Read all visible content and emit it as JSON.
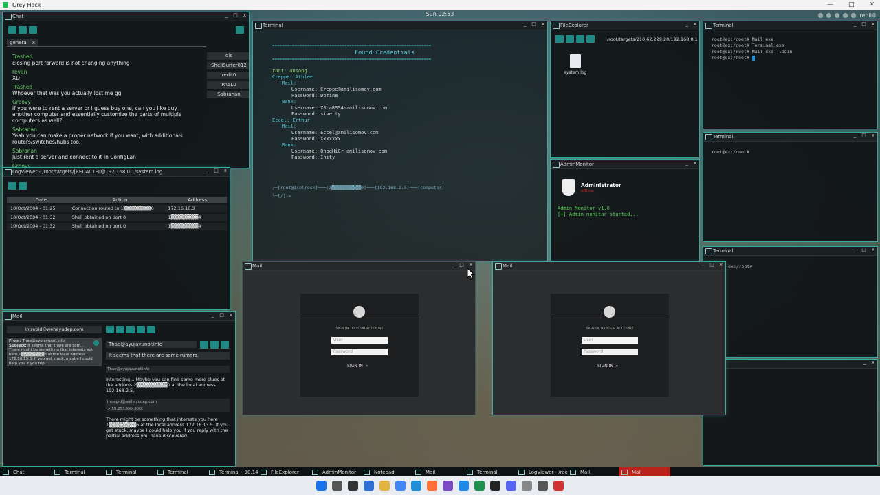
{
  "host": {
    "title": "Grey Hack"
  },
  "clock": "Sun 02:53",
  "tray": {
    "user": "redit0"
  },
  "chat": {
    "title": "Chat",
    "channel": "general",
    "channel_close": "x",
    "messages": [
      {
        "name": "Trashed",
        "text": "closing port forward is not changing anything"
      },
      {
        "name": "revan",
        "text": "XD"
      },
      {
        "name": "Trashed",
        "text": "Whoever that was you actually lost me gg"
      },
      {
        "name": "Groovy",
        "text": "if you were to rent a server or i guess buy one, can you like buy another computer and essentially customize the parts of multiple computers as well?"
      },
      {
        "name": "Sabranan",
        "text": "Yeah you can make a proper network if you want, with additionals routers/switches/hubs too."
      },
      {
        "name": "Sabranan",
        "text": "Just rent a server and connect to it in ConfigLan"
      },
      {
        "name": "Groovy",
        "text": ""
      }
    ],
    "users": [
      "dis",
      "ShellSurfer012",
      "redit0",
      "PA5L0",
      "Sabranan"
    ]
  },
  "logviewer": {
    "title": "LogViewer - /root/targets/[REDACTED]/192.168.0.1/system.log",
    "headers": [
      "Date",
      "Action",
      "Address"
    ],
    "rows": [
      {
        "date": "10/Oct/2004 - 01:25",
        "action": "Connection routed to 1▓▓▓▓▓▓▓▓6",
        "address": "172.16.16.3"
      },
      {
        "date": "10/Oct/2004 - 01:32",
        "action": "Shell obtained on port 0",
        "address": "1▓▓▓▓▓▓▓▓4"
      },
      {
        "date": "10/Oct/2004 - 01:32",
        "action": "Shell obtained on port 0",
        "address": "1▓▓▓▓▓▓▓▓4"
      }
    ]
  },
  "mail_left": {
    "title": "Mail",
    "account": "intrepid@wehayudep.com",
    "preview": {
      "from_label": "From:",
      "from": "Thae@ayujavunof.info",
      "subject_label": "Subject:",
      "subject": "It seems that there are som...",
      "body": "There might be something that interests you here 1▓▓▓▓▓▓▓▓6 at the local address 172.16.13.5. If you get stuck, maybe I could help you if you repl"
    },
    "to": "Thae@ayujavunof.info",
    "subject_line": "It seems that there are some rumors.",
    "thread": [
      {
        "sender": "Thae@ayujavunof.info",
        "body": "Interesting... Maybe you can find some more clues at the address 2▓▓▓▓▓▓▓▓▓0 at the local address 192.168.2.5."
      },
      {
        "sender": "intrepid@wehayudep.com",
        "body": "> 59.253.XXX.XXX"
      },
      {
        "sender": "",
        "body": "There might be something that interests you here 1▓▓▓▓▓▓▓▓6 at the local address 172.16.13.5. If you get stuck, maybe I could help you if you reply with the partial address you have discovered."
      }
    ]
  },
  "terminal_main": {
    "title": "Terminal",
    "rule": "================================================================",
    "heading": "Found Credentials",
    "lines": [
      {
        "t": "root: ansong",
        "c": "t-green",
        "i": 0
      },
      {
        "t": "Creppe: Athlee",
        "c": "t-cyan",
        "i": 0
      },
      {
        "t": "Mail:",
        "c": "t-cyan",
        "i": 1
      },
      {
        "t": "Username: Creppe@amilisomov.com",
        "c": "t-white",
        "i": 2
      },
      {
        "t": "Password: Domine",
        "c": "t-white",
        "i": 2
      },
      {
        "t": "Bank:",
        "c": "t-cyan",
        "i": 1
      },
      {
        "t": "Username: XSLaRSS4-amilisomov.com",
        "c": "t-white",
        "i": 2
      },
      {
        "t": "Password: siverty",
        "c": "t-white",
        "i": 2
      },
      {
        "t": "Eccel: Erthur",
        "c": "t-cyan",
        "i": 0
      },
      {
        "t": "Mail:",
        "c": "t-cyan",
        "i": 1
      },
      {
        "t": "Username: Eccel@amilisomov.com",
        "c": "t-white",
        "i": 2
      },
      {
        "t": "Password: Xxxxxxx",
        "c": "t-white",
        "i": 2
      },
      {
        "t": "Bank:",
        "c": "t-cyan",
        "i": 1
      },
      {
        "t": "Username: 8nodHiGr-amilisomov.com",
        "c": "t-white",
        "i": 2
      },
      {
        "t": "Password: Inity",
        "c": "t-white",
        "i": 2
      }
    ],
    "prompt1": "┌─[root@Ixelrock]───[2▓▓▓▓▓▓▓▓▓▓▓0]───[192.168.2.5]───[computer]",
    "prompt2": "└─[/]-»"
  },
  "file_explorer": {
    "title": "FileExplorer",
    "path": "/root/targets/210.62.229.20/192.168.0.1",
    "files": [
      "system.log"
    ]
  },
  "terminal_right1": {
    "title": "Terminal",
    "lines": [
      "root@ex:/root# Mail.exe",
      "root@ex:/root# Terminal.exe",
      "root@ex:/root# Mail.exe -login",
      "root@ex:/root# "
    ]
  },
  "terminal_right2": {
    "title": "Terminal",
    "lines": [
      "root@ex:/root#"
    ]
  },
  "terminal_right3": {
    "title": "Terminal",
    "lines": [
      "ex:/root#"
    ]
  },
  "admin_monitor": {
    "title": "AdminMonitor",
    "user": "Administrator",
    "status": "offline",
    "lines": [
      "Admin Monitor v1.0",
      "[+] Admin monitor started..."
    ]
  },
  "mail_login_1": {
    "title": "Mail",
    "heading": "SIGN IN TO YOUR ACCOUNT",
    "user_placeholder": "User",
    "password_placeholder": "Password",
    "button": "SIGN IN"
  },
  "mail_login_2": {
    "title": "Mail",
    "heading": "SIGN IN TO YOUR ACCOUNT",
    "user_placeholder": "User",
    "password_placeholder": "Password",
    "button": "SIGN IN"
  },
  "taskbar": [
    {
      "label": "Chat",
      "active": false
    },
    {
      "label": "Terminal",
      "active": false
    },
    {
      "label": "Terminal",
      "active": false
    },
    {
      "label": "Terminal",
      "active": false
    },
    {
      "label": "Terminal - 90.14...",
      "active": false
    },
    {
      "label": "FileExplorer",
      "active": false
    },
    {
      "label": "AdminMonitor",
      "active": false
    },
    {
      "label": "Notepad",
      "active": false
    },
    {
      "label": "Mail",
      "active": false
    },
    {
      "label": "Terminal",
      "active": false
    },
    {
      "label": "LogViewer - /roo...",
      "active": false
    },
    {
      "label": "Mail",
      "active": false
    },
    {
      "label": "Mail",
      "active": true
    }
  ],
  "os_taskbar_icons": [
    "windows-start-icon",
    "search-icon",
    "task-view-icon",
    "widgets-icon",
    "folder-icon",
    "chrome-icon",
    "edge-icon",
    "firefox-icon",
    "visual-studio-icon",
    "vscode-icon",
    "excel-icon",
    "terminal-icon",
    "discord-icon",
    "app-icon",
    "app-icon",
    "app-icon"
  ]
}
